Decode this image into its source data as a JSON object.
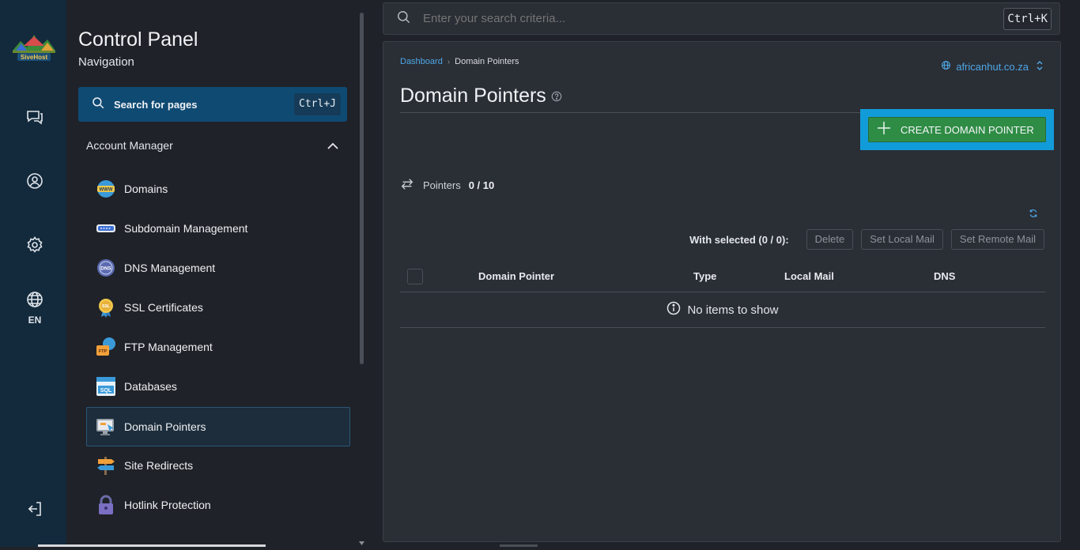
{
  "rail": {
    "logo_text": "SiveHost",
    "items": [
      {
        "icon": "chat-icon"
      },
      {
        "icon": "user-circle-icon"
      },
      {
        "icon": "gear-icon"
      },
      {
        "icon": "globe-icon"
      }
    ],
    "language": "EN",
    "logout_icon": "logout-icon"
  },
  "nav": {
    "title": "Control Panel",
    "subtitle": "Navigation",
    "search_label": "Search for pages",
    "search_shortcut": "Ctrl+J",
    "section": "Account Manager",
    "items": [
      {
        "label": "Domains",
        "icon": "www-globe-icon"
      },
      {
        "label": "Subdomain Management",
        "icon": "subdomain-icon"
      },
      {
        "label": "DNS Management",
        "icon": "dns-icon"
      },
      {
        "label": "SSL Certificates",
        "icon": "ssl-badge-icon"
      },
      {
        "label": "FTP Management",
        "icon": "ftp-folder-icon"
      },
      {
        "label": "Databases",
        "icon": "sql-database-icon"
      },
      {
        "label": "Domain Pointers",
        "icon": "monitor-pointer-icon",
        "active": true
      },
      {
        "label": "Site Redirects",
        "icon": "signpost-icon"
      },
      {
        "label": "Hotlink Protection",
        "icon": "padlock-icon"
      }
    ]
  },
  "topbar": {
    "search_placeholder": "Enter your search criteria...",
    "shortcut": "Ctrl+K"
  },
  "main": {
    "breadcrumb": {
      "root": "Dashboard",
      "current": "Domain Pointers"
    },
    "domain": "africanhut.co.za",
    "title": "Domain Pointers",
    "create_button": "CREATE DOMAIN POINTER",
    "pointers_label": "Pointers",
    "pointers_value": "0 / 10",
    "with_selected": "With selected (0 / 0):",
    "bulk_actions": [
      "Delete",
      "Set Local Mail",
      "Set Remote Mail"
    ],
    "columns": [
      "Domain Pointer",
      "Type",
      "Local Mail",
      "DNS"
    ],
    "empty_text": "No items to show"
  },
  "colors": {
    "accent": "#4ea7e6",
    "create_button": "#2f8c45",
    "focus_ring": "#129bd9",
    "rail_bg": "#132a3c",
    "nav_search_bg": "#0f4a73"
  }
}
